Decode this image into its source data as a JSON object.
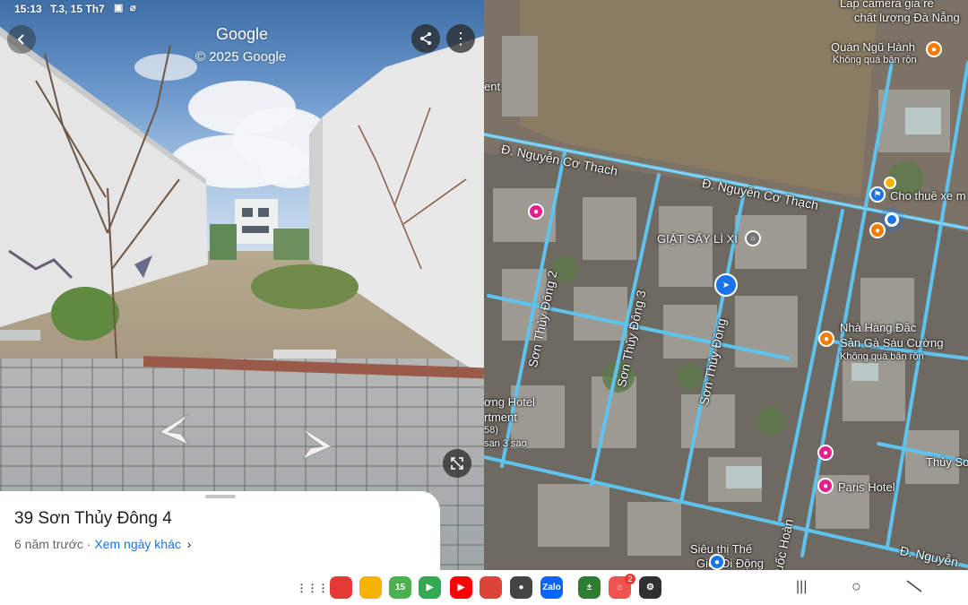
{
  "status": {
    "time": "15:13",
    "date": "T.3, 15 Th7"
  },
  "street_view": {
    "brand": "Google",
    "copyright": "© 2025 Google",
    "card": {
      "title": "39 Sơn Thủy Đông 4",
      "age": "6 năm trước",
      "separator": "·",
      "link": "Xem ngày khác",
      "chevron": "›"
    },
    "icons": {
      "back": "back-arrow-icon",
      "share": "share-icon",
      "more": "more-vert-icon",
      "expand": "expand-icon"
    }
  },
  "map": {
    "labels": {
      "top_right_1": "Lắp camera giá rẻ",
      "top_right_2": "chất lượng Đà Nẵng",
      "quan_ngu_hanh": "Quán Ngũ Hành",
      "khong_qua_1": "Không quá bận rộn",
      "ent": "ent",
      "street_ncthach_1": "Đ. Nguyễn Cơ Thạch",
      "street_ncthach_2": "Đ. Nguyễn Cơ Thạch",
      "cho_thue": "Cho thuê xe m",
      "giat_say": "GIẶT SẤY LÌ XÌ",
      "son_thuy_2": "Sơn Thủy Đông 2",
      "son_thuy_3": "Sơn Thủy Đông 3",
      "son_thuy_dong": "Sơn Thủy Đông",
      "nha_hang_1": "Nhà Hàng Đặc",
      "nha_hang_2": "Sản Gà Sáu Cường",
      "khong_qua_2": "Không quá bận rộn",
      "hotel_1": "ơng Hotel",
      "hotel_2": "rtment",
      "hotel_3": "58)",
      "hotel_4": "san 3 sao",
      "thuy_so": "Thủy Sơ",
      "paris": "Paris Hotel",
      "sieu_thi_1": "Siêu thị Thế",
      "sieu_thi_2": "Giới Di Động",
      "quoc_hoan": "uốc Hoàn",
      "nguyen_bottom": "Đ. Nguyễn"
    }
  },
  "taskbar": {
    "apps": [
      {
        "name": "apps-grid-icon",
        "label": "⋮⋮⋮",
        "color": "#ffffff"
      },
      {
        "name": "notes-red-icon",
        "label": "",
        "color": "#e53935"
      },
      {
        "name": "notes-yellow-icon",
        "label": "",
        "color": "#f5b400"
      },
      {
        "name": "calendar-icon",
        "label": "15",
        "color": "#4caf50"
      },
      {
        "name": "play-store-icon",
        "label": "▶",
        "color": "#34a853"
      },
      {
        "name": "youtube-icon",
        "label": "▶",
        "color": "#ff0000"
      },
      {
        "name": "chrome-icon",
        "label": "",
        "color": "#db4437"
      },
      {
        "name": "camera-icon",
        "label": "●",
        "color": "#444444"
      },
      {
        "name": "zalo-icon",
        "label": "Zalo",
        "color": "#0068ff"
      },
      {
        "name": "calculator-icon",
        "label": "±",
        "color": "#2e7d32"
      },
      {
        "name": "home-app-icon",
        "label": "⌂",
        "color": "#ef5350"
      },
      {
        "name": "settings-icon",
        "label": "⚙",
        "color": "#303030"
      }
    ],
    "badge": "2",
    "nav": {
      "recents": "|||",
      "home": "○",
      "back": "〈"
    }
  }
}
